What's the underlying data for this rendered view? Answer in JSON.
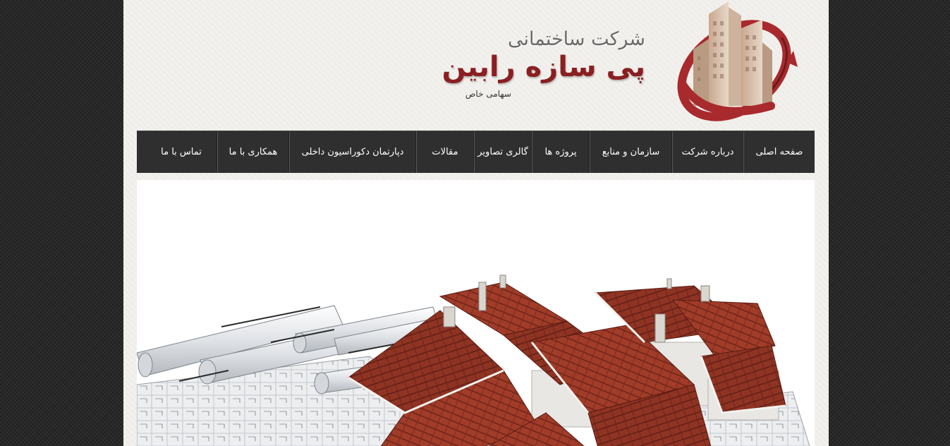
{
  "header": {
    "company_type": "شرکت ساختمانی",
    "company_name": "پی سازه رابین",
    "company_suffix": "سهامی خاص",
    "logo_icon": "building-arrow-logo",
    "brand_color": "#8a1f22"
  },
  "nav": {
    "items": [
      {
        "label": "صفحه اصلی"
      },
      {
        "label": "درباره شرکت"
      },
      {
        "label": "سازمان و منابع"
      },
      {
        "label": "پروژه ها"
      },
      {
        "label": "گالری تصاویر"
      },
      {
        "label": "مقالات"
      },
      {
        "label": "دپارتمان دکوراسیون داخلی"
      },
      {
        "label": "همکاری با ما"
      },
      {
        "label": "تماس با ما"
      }
    ]
  },
  "hero": {
    "image": "house-roofs-blueprints-illustration"
  }
}
